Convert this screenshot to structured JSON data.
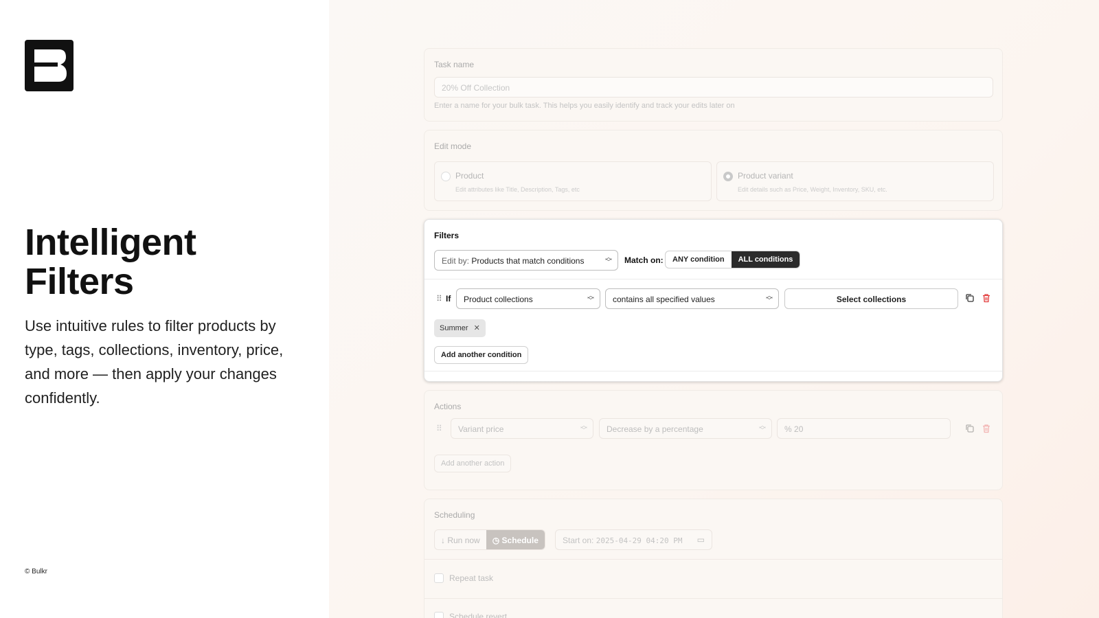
{
  "brand": {
    "logo_letter": "B",
    "copyright": "© Bulkr"
  },
  "hero": {
    "headline_line1": "Intelligent",
    "headline_line2": "Filters",
    "description": "Use intuitive rules to filter products by type, tags, collections, inventory, price, and more — then apply your changes confidently."
  },
  "task": {
    "label": "Task name",
    "placeholder": "20% Off Collection",
    "help": "Enter a name for your bulk task. This helps you easily identify and track your edits later on"
  },
  "edit_mode": {
    "label": "Edit mode",
    "options": [
      {
        "label": "Product",
        "desc": "Edit attributes like Title, Description, Tags, etc",
        "selected": false
      },
      {
        "label": "Product variant",
        "desc": "Edit details such as Price, Weight, Inventory, SKU, etc.",
        "selected": true
      }
    ]
  },
  "filters": {
    "title": "Filters",
    "edit_by_prefix": "Edit by:",
    "edit_by_value": "Products that match conditions",
    "match_label": "Match on:",
    "match_options": [
      "ANY condition",
      "ALL conditions"
    ],
    "match_selected": "ALL conditions",
    "condition": {
      "if_label": "If",
      "field": "Product collections",
      "operator": "contains all specified values",
      "select_button": "Select collections",
      "tags": [
        "Summer"
      ]
    },
    "add_condition": "Add another condition"
  },
  "actions": {
    "title": "Actions",
    "field": "Variant price",
    "operation": "Decrease by a percentage",
    "value_prefix": "%",
    "value": "20",
    "add_action": "Add another action"
  },
  "scheduling": {
    "title": "Scheduling",
    "run_now": "Run now",
    "schedule": "Schedule",
    "start_prefix": "Start on:",
    "start_value": "2025-04-29 04:20 PM",
    "repeat_label": "Repeat task",
    "revert_label": "Schedule revert"
  },
  "colors": {
    "accent_dark": "#2b2b2b",
    "delete_red": "#e23b3b",
    "background_peach": "#fcf5f0"
  }
}
